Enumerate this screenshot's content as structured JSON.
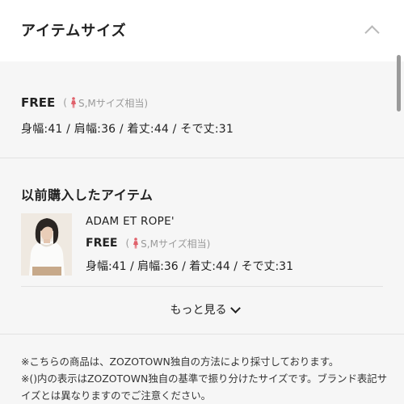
{
  "section": {
    "title": "アイテムサイズ"
  },
  "current_item": {
    "size": "FREE",
    "hint_open": "(",
    "hint_text": "S,Mサイズ相当)",
    "measurements": "身幅:41 / 肩幅:36 / 着丈:44 / そで丈:31"
  },
  "previous": {
    "title": "以前購入したアイテム",
    "items": [
      {
        "brand": "ADAM ET ROPE'",
        "size": "FREE",
        "hint_open": "(",
        "hint_text": "S,Mサイズ相当)",
        "measurements": "身幅:41 / 肩幅:36 / 着丈:44 / そで丈:31"
      }
    ],
    "more_label": "もっと見る"
  },
  "notes": [
    "※こちらの商品は、ZOZOTOWN独自の方法により採寸しております。",
    "※()内の表示はZOZOTOWN独自の基準で振り分けたサイズです。ブランド表記サイズとは異なりますのでご注意ください。"
  ],
  "colors": {
    "accent_figure": "#e0616b",
    "background": "#f6f6f6",
    "header_bg": "#ffffff"
  },
  "icons": {
    "collapse": "chevron-up-icon",
    "figure": "female-figure-icon",
    "more": "chevron-down-icon"
  }
}
